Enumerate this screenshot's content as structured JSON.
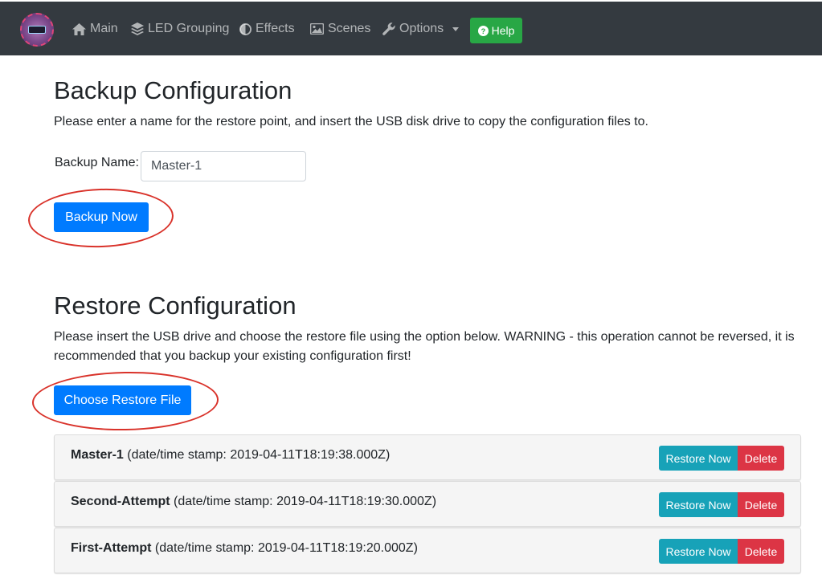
{
  "navbar": {
    "items": [
      {
        "label": "Main",
        "icon": "home-icon"
      },
      {
        "label": "LED Grouping",
        "icon": "layers-icon"
      },
      {
        "label": "Effects",
        "icon": "adjust-icon"
      },
      {
        "label": "Scenes",
        "icon": "image-icon"
      },
      {
        "label": "Options",
        "icon": "wrench-icon"
      }
    ],
    "help_label": "Help",
    "colors": {
      "background": "#343a40",
      "help": "#28a745"
    }
  },
  "backup": {
    "title": "Backup Configuration",
    "description": "Please enter a name for the restore point, and insert the USB disk drive to copy the configuration files to.",
    "name_label": "Backup Name:",
    "name_value": "Master-1",
    "button_label": "Backup Now"
  },
  "restore": {
    "title": "Restore Configuration",
    "description": "Please insert the USB drive and choose the restore file using the option below. WARNING - this operation cannot be reversed, it is recommended that you backup your existing configuration first!",
    "choose_button_label": "Choose Restore File",
    "items": [
      {
        "name": "Master-1",
        "stamp": "(date/time stamp: 2019-04-11T18:19:38.000Z)",
        "restore_label": "Restore Now",
        "delete_label": "Delete"
      },
      {
        "name": "Second-Attempt",
        "stamp": "(date/time stamp: 2019-04-11T18:19:30.000Z)",
        "restore_label": "Restore Now",
        "delete_label": "Delete"
      },
      {
        "name": "First-Attempt",
        "stamp": "(date/time stamp: 2019-04-11T18:19:20.000Z)",
        "restore_label": "Restore Now",
        "delete_label": "Delete"
      }
    ]
  },
  "colors": {
    "primary": "#007bff",
    "info": "#17a2b8",
    "danger": "#dc3545",
    "annotation": "#d9322a"
  }
}
